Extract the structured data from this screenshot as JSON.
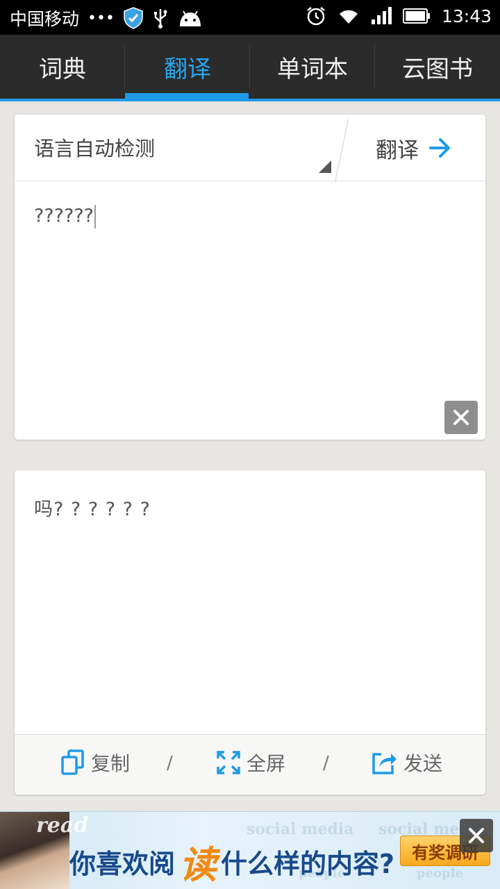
{
  "status_bar": {
    "carrier": "中国移动",
    "dots": "•••",
    "time": "13:43"
  },
  "tabs": [
    {
      "label": "词典",
      "active": false
    },
    {
      "label": "翻译",
      "active": true
    },
    {
      "label": "单词本",
      "active": false
    },
    {
      "label": "云图书",
      "active": false
    }
  ],
  "input_card": {
    "language_select": "语言自动检测",
    "translate_label": "翻译",
    "input_value": "??????"
  },
  "output_card": {
    "result_text": "吗? ? ? ? ? ?",
    "copy_label": "复制",
    "fullscreen_label": "全屏",
    "send_label": "发送",
    "separator": "/"
  },
  "ad": {
    "read_text": "read",
    "headline_part1": "你喜欢阅",
    "headline_accent": "读",
    "headline_part2": "什么样的内容?",
    "survey_button": "有奖调研"
  },
  "colors": {
    "accent": "#1e9be8",
    "tab_bar": "#2b2b2b",
    "background": "#e8e6e2"
  }
}
